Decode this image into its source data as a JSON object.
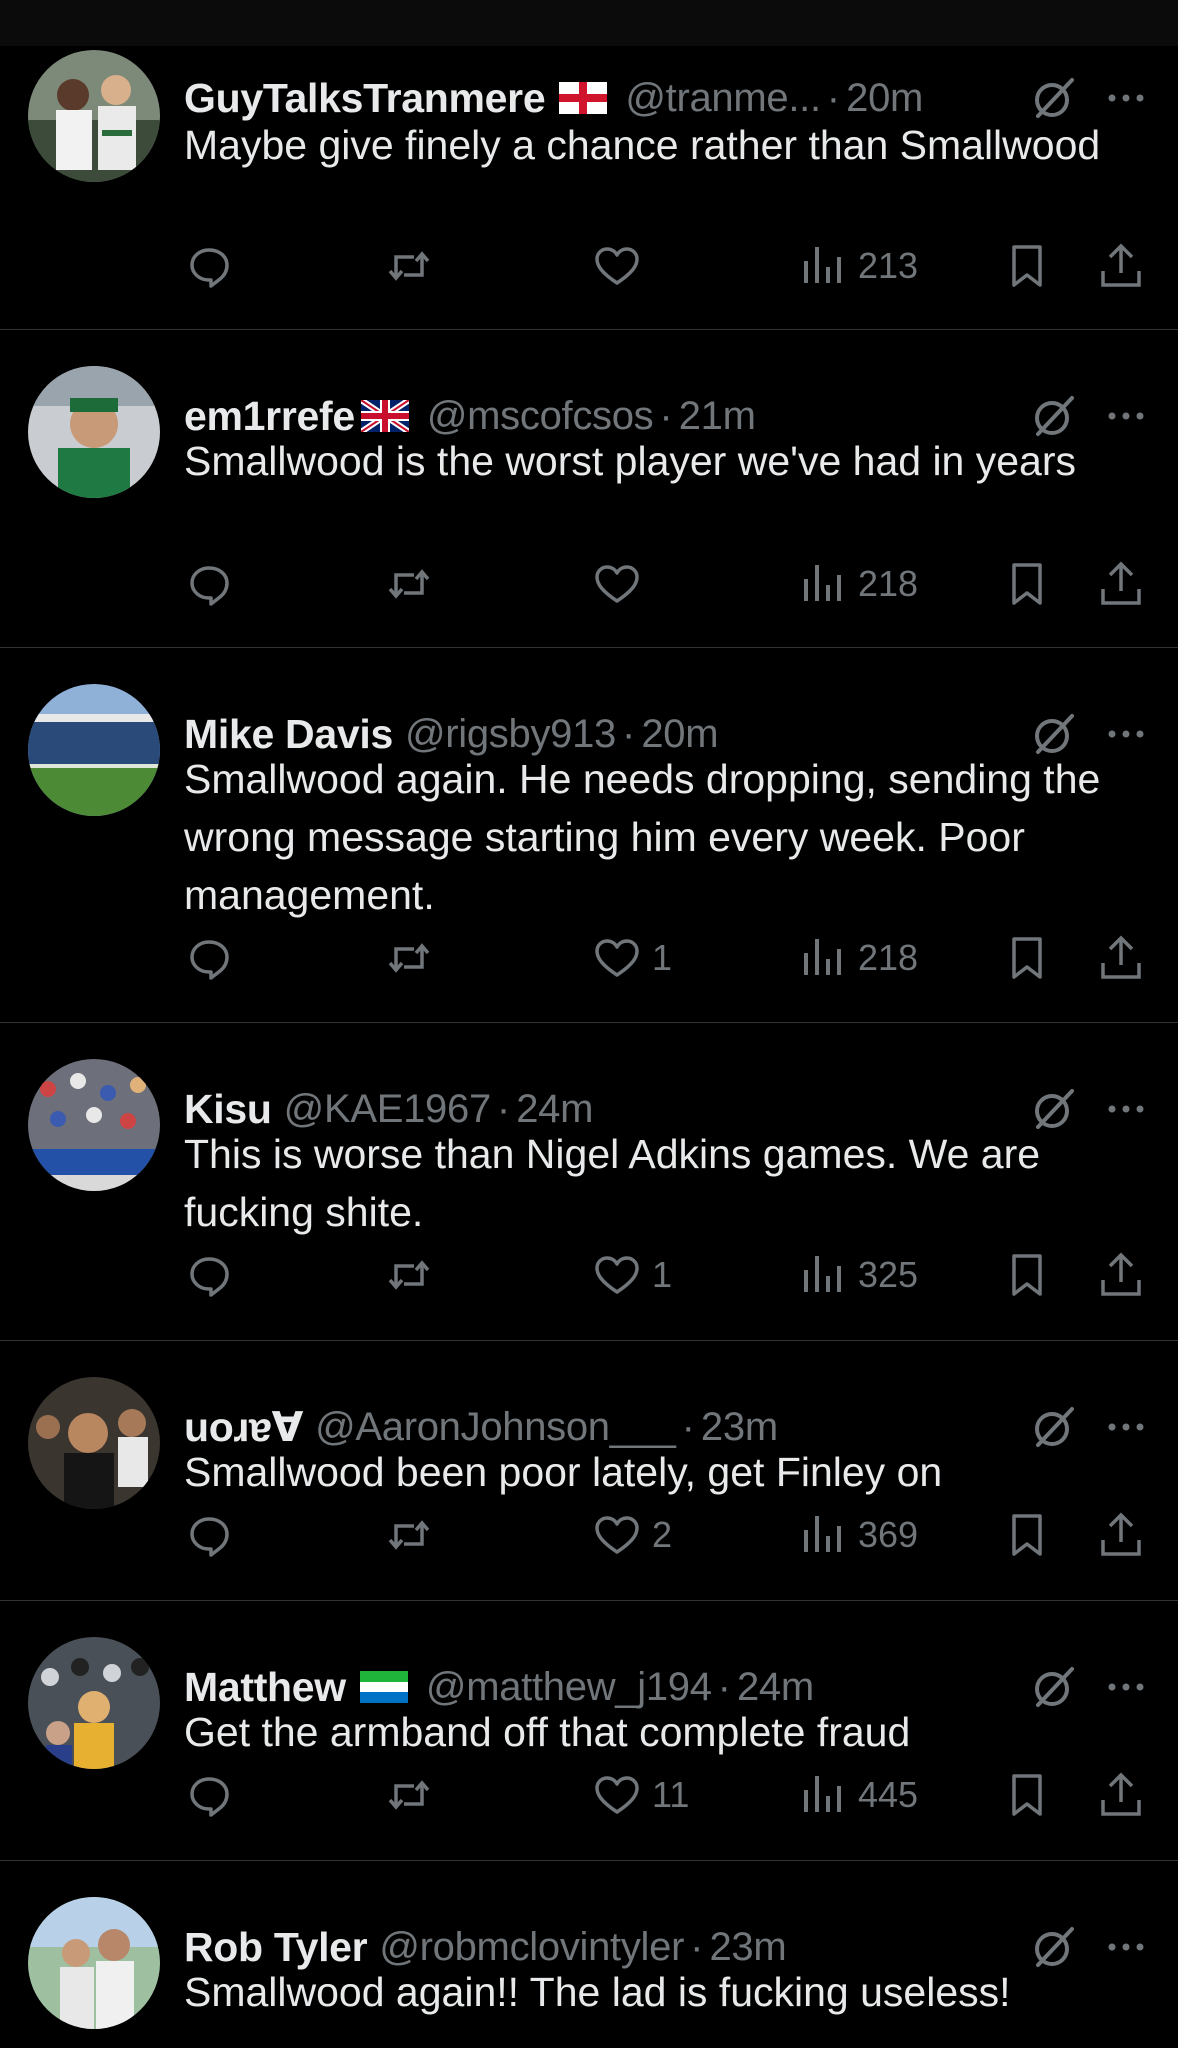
{
  "tweets": [
    {
      "name": "GuyTalksTranmere",
      "flag": "england",
      "handle": "@tranme...",
      "time": "20m",
      "text": "Maybe give finely a chance rather than Smallwood",
      "likes": "",
      "views": "213"
    },
    {
      "name": "em1rrefe",
      "flag": "uk",
      "handle": "@mscofcsos",
      "time": "21m",
      "text": "Smallwood is the worst player we've had in years",
      "likes": "",
      "views": "218"
    },
    {
      "name": "Mike Davis",
      "flag": "",
      "handle": "@rigsby913",
      "time": "20m",
      "text": "Smallwood again. He needs dropping, sending the wrong message starting him every week. Poor management.",
      "likes": "1",
      "views": "218"
    },
    {
      "name": "Kisu",
      "flag": "",
      "handle": "@KAE1967",
      "time": "24m",
      "text": "This is worse than Nigel Adkins games. We are fucking shite.",
      "likes": "1",
      "views": "325"
    },
    {
      "name": "uoɹɐ∀",
      "flag": "",
      "handle": "@AaronJohnson___",
      "time": "23m",
      "text": "Smallwood been poor lately, get Finley on",
      "likes": "2",
      "views": "369"
    },
    {
      "name": "Matthew",
      "flag": "sierra-leone",
      "handle": "@matthew_j194",
      "time": "24m",
      "text": "Get the armband off that complete fraud",
      "likes": "11",
      "views": "445"
    },
    {
      "name": "Rob Tyler",
      "flag": "",
      "handle": "@robmclovintyler",
      "time": "23m",
      "text": "Smallwood again!! The lad is fucking useless!",
      "likes": "",
      "views": ""
    }
  ],
  "icons": {
    "reply": "reply-icon",
    "retweet": "retweet-icon",
    "like": "heart-icon",
    "views": "views-icon",
    "bookmark": "bookmark-icon",
    "share": "share-icon",
    "grok": "grok-icon",
    "more": "more-icon"
  },
  "colors": {
    "background": "#000000",
    "text": "#e7e9ea",
    "muted": "#71767b",
    "divider": "#2f3336"
  }
}
